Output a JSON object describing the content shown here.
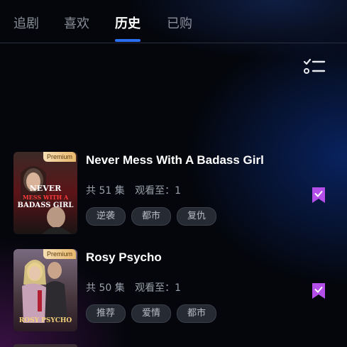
{
  "tabs": [
    {
      "label": "追剧",
      "active": false
    },
    {
      "label": "喜欢",
      "active": false
    },
    {
      "label": "历史",
      "active": true
    },
    {
      "label": "已购",
      "active": false
    }
  ],
  "toolbar": {
    "filter_icon": "checklist-icon"
  },
  "colors": {
    "accent": "#2a6ff0",
    "bookmark": "#b34ee8",
    "premium": "#e8b86d"
  },
  "history": [
    {
      "title": "Never Mess With A Badass Girl",
      "badge": "Premium",
      "episodes_label": "共 51 集",
      "progress_label": "观看至：1",
      "tags": [
        "逆袭",
        "都市",
        "复仇"
      ],
      "cover_text": [
        "NEVER",
        "MESS WITH A",
        "BADASS GIRL"
      ],
      "bookmarked": true
    },
    {
      "title": "Rosy Psycho",
      "badge": "Premium",
      "episodes_label": "共 50 集",
      "progress_label": "观看至：1",
      "tags": [
        "推荐",
        "爱情",
        "都市"
      ],
      "cover_text": [
        "ROSY PSYCHO"
      ],
      "bookmarked": true
    }
  ]
}
